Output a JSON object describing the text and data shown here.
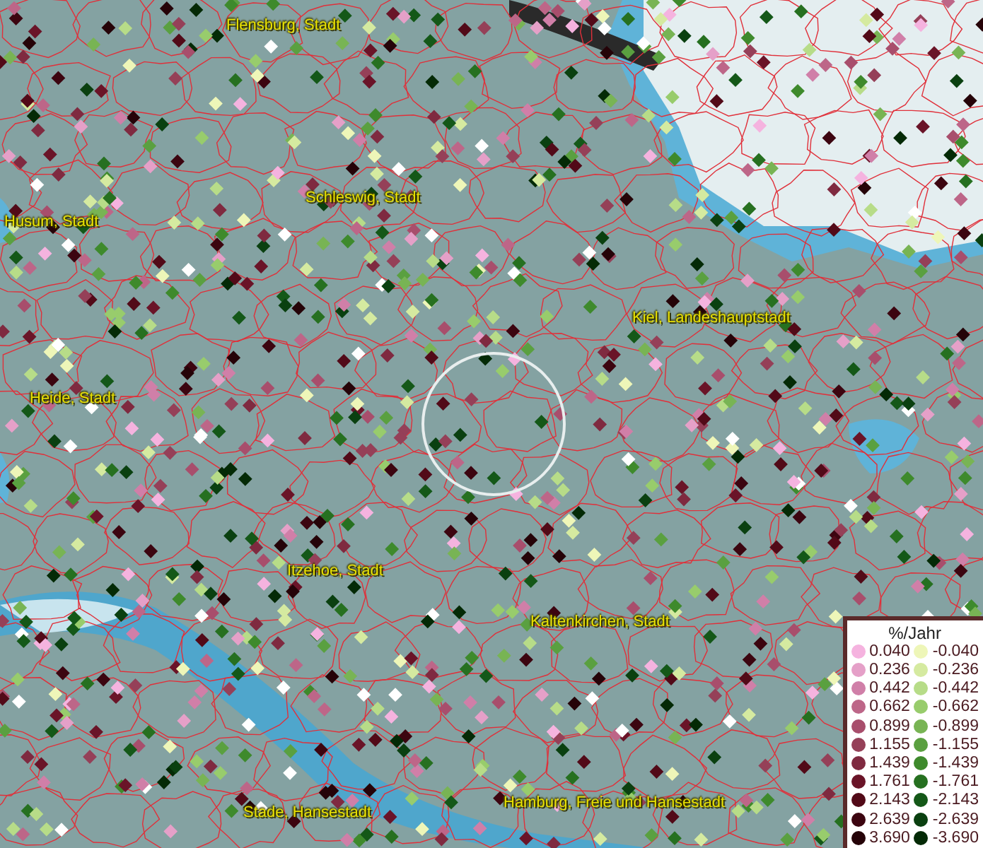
{
  "map": {
    "places": [
      {
        "kind": "city",
        "name": "Flensburg, Stadt"
      },
      {
        "kind": "city",
        "name": "Schleswig, Stadt"
      },
      {
        "kind": "city",
        "name": "Husum, Stadt"
      },
      {
        "kind": "city",
        "name": "Kiel, Landeshauptstadt"
      },
      {
        "kind": "city",
        "name": "Heide, Stadt"
      },
      {
        "kind": "city",
        "name": "Itzehoe, Stadt"
      },
      {
        "kind": "city",
        "name": "Kaltenkirchen, Stadt"
      },
      {
        "kind": "city",
        "name": "Stade, Hansestadt"
      },
      {
        "kind": "city",
        "name": "Hamburg, Freie und Hansestadt"
      }
    ]
  },
  "legend": {
    "title": "%/Jahr",
    "rows": [
      {
        "left": {
          "label": "0.040",
          "color": "#f5b3df"
        },
        "right": {
          "label": "-0.040",
          "color": "#eef6b8"
        }
      },
      {
        "left": {
          "label": "0.236",
          "color": "#e5a0c8"
        },
        "right": {
          "label": "-0.236",
          "color": "#d5eaa0"
        }
      },
      {
        "left": {
          "label": "0.442",
          "color": "#d07fa8"
        },
        "right": {
          "label": "-0.442",
          "color": "#b7dc88"
        }
      },
      {
        "left": {
          "label": "0.662",
          "color": "#bd6688"
        },
        "right": {
          "label": "-0.662",
          "color": "#98cc6c"
        }
      },
      {
        "left": {
          "label": "0.899",
          "color": "#a84e6c"
        },
        "right": {
          "label": "-0.899",
          "color": "#78b454"
        }
      },
      {
        "left": {
          "label": "1.155",
          "color": "#954058"
        },
        "right": {
          "label": "-1.155",
          "color": "#5aa040"
        }
      },
      {
        "left": {
          "label": "1.439",
          "color": "#7f2a40"
        },
        "right": {
          "label": "-1.439",
          "color": "#3e8a2c"
        }
      },
      {
        "left": {
          "label": "1.761",
          "color": "#6a1428"
        },
        "right": {
          "label": "-1.761",
          "color": "#267020"
        }
      },
      {
        "left": {
          "label": "2.143",
          "color": "#520a18"
        },
        "right": {
          "label": "-2.143",
          "color": "#145818"
        }
      },
      {
        "left": {
          "label": "2.639",
          "color": "#3c0510"
        },
        "right": {
          "label": "-2.639",
          "color": "#0a4010"
        }
      },
      {
        "left": {
          "label": "3.690",
          "color": "#250308"
        },
        "right": {
          "label": "-3.690",
          "color": "#042a06"
        }
      }
    ]
  }
}
